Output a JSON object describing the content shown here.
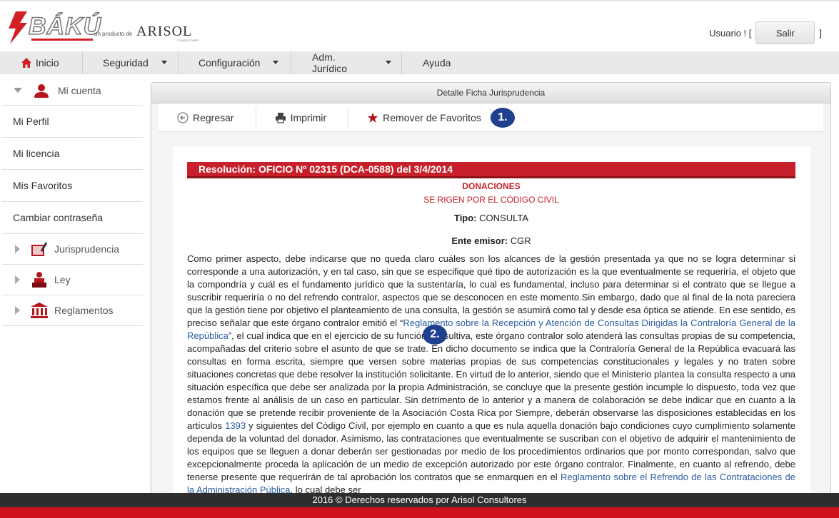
{
  "brand": {
    "name": "BÁKÚ",
    "tagline": "un producto de",
    "company": "ARISOL",
    "company_sub": "CONSULTORES",
    "accent_color": "#d21f26"
  },
  "user": {
    "label_before": "Usuario ! [",
    "logout_label": "Salir",
    "label_after": "]"
  },
  "nav": {
    "items": [
      {
        "label": "Inicio",
        "icon": "home-icon"
      },
      {
        "label": "Seguridad"
      },
      {
        "label": "Configuración"
      },
      {
        "label": "Adm. Jurídico"
      },
      {
        "label": "Ayuda"
      }
    ]
  },
  "sidebar": {
    "account_label": "Mi cuenta",
    "links": [
      "Mi Perfil",
      "Mi licencia",
      "Mis Favoritos",
      "Cambiar contraseña"
    ],
    "groups": [
      {
        "label": "Jurisprudencia",
        "icon": "book-icon"
      },
      {
        "label": "Ley",
        "icon": "judge-icon"
      },
      {
        "label": "Reglamentos",
        "icon": "building-icon"
      }
    ]
  },
  "panel": {
    "title": "Detalle Ficha Jurisprudencia",
    "toolbar": {
      "back": "Regresar",
      "print": "Imprimir",
      "favorite": "Remover de Favoritos",
      "badge1": "1."
    }
  },
  "doc": {
    "resolution": "Resolución:  OFICIO Nº 02315 (DCA-0588)   del  3/4/2014",
    "subject": "DONACIONES",
    "subtitle": "SE RIGEN POR EL CÓDIGO CIVIL",
    "tipo_label": "Tipo:",
    "tipo_value": "CONSULTA",
    "ente_label": "Ente emisor:",
    "ente_value": "CGR",
    "badge2": "2.",
    "p1": "Como primer aspecto, debe indicarse que no queda claro cuáles son los alcances de la gestión presentada ya que no se logra determinar si corresponde a una autorización, y en tal caso, sin que se especifique qué tipo de autorización es la que eventualmente se requeriría, el objeto que la compondría y cuál es el fundamento jurídico que la sustentaría, lo cual es fundamental, incluso para determinar si el contrato que se llegue a suscribir requeriría o no del refrendo contralor, aspectos que se desconocen en este momento.Sin embargo, dado que al final de la nota pareciera que la gestión tiene por objetivo el planteamiento de una consulta, la gestión se asumirá como tal y desde esa óptica se atiende. En ese sentido, es preciso señalar que este órgano contralor emitió el “",
    "link1": "Reglamento sobre la Recepción y Atención de Consultas Dirigidas la Contraloría General de la República",
    "p2": "”, el cual indica que en el ejercicio de su función consultiva, este órgano contralor solo atenderá las consultas propias de su competencia, acompañadas del criterio sobre el asunto de que se trate. En dicho documento se indica que la Contraloría General de la República evacuará las consultas en forma escrita, siempre que versen sobre materias propias de sus competencias constitucionales y legales y no traten sobre situaciones concretas que debe resolver la institución solicitante. En virtud de lo anterior, siendo que el Ministerio plantea la consulta respecto a una situación específica que debe ser analizada por la propia Administración, se concluye que la presente gestión incumple lo dispuesto, toda vez que estamos frente al análisis de un caso en particular. Sin detrimento de lo anterior y a manera de colaboración se debe indicar que en cuanto a la donación que se pretende recibir proveniente de la Asociación Costa Rica por Siempre, deberán observarse las disposiciones establecidas en los artículos ",
    "link2": "1393",
    "p3": " y siguientes del Código Civil, por ejemplo en cuanto a que es nula aquella donación bajo condiciones cuyo cumplimiento solamente dependa de la voluntad del donador. Asimismo, las contrataciones que eventualmente se suscriban con el objetivo de adquirir el mantenimiento de los equipos que se lleguen a donar deberán ser gestionadas por medio de los procedimientos ordinarios que por monto correspondan, salvo que excepcionalmente proceda la aplicación de un medio de excepción autorizado por este órgano contralor. Finalmente, en cuanto al refrendo, debe tenerse presente que requerirán de tal aprobación los contratos que se enmarquen en el ",
    "link3": "Reglamento sobre el Refrendo de las Contrataciones de la Administración Pública",
    "p4": ", lo cual debe ser"
  },
  "footer": {
    "text": "2016 © Derechos reservados por Arisol Consultores"
  }
}
